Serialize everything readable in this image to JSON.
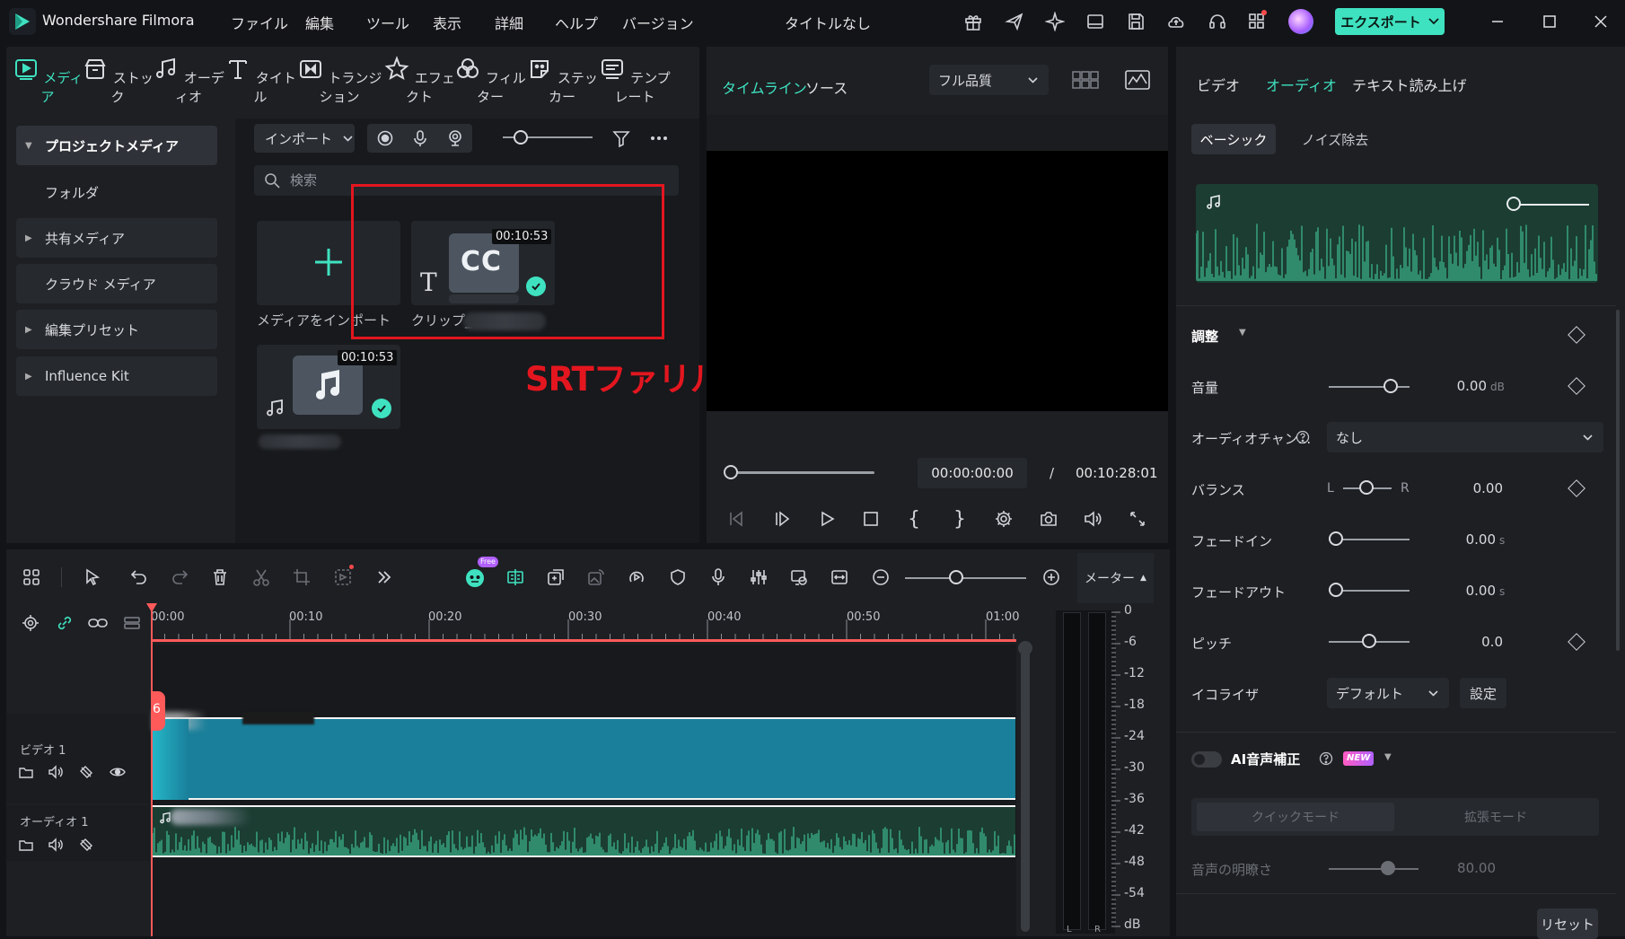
{
  "titlebar": {
    "app_name": "Wondershare Filmora",
    "menu": [
      "ファイル",
      "編集",
      "ツール",
      "表示",
      "詳細",
      "ヘルプ",
      "バージョン"
    ],
    "document_title": "タイトルなし",
    "export_label": "エクスポート"
  },
  "media_tabs": [
    {
      "label": "メディア",
      "icon": "media-icon"
    },
    {
      "label": "ストック",
      "icon": "stock-icon"
    },
    {
      "label": "オーディオ",
      "icon": "music-note-icon"
    },
    {
      "label": "タイトル",
      "icon": "title-t-icon"
    },
    {
      "label": "トランジション",
      "icon": "transition-icon"
    },
    {
      "label": "エフェクト",
      "icon": "effect-star-icon"
    },
    {
      "label": "フィルター",
      "icon": "filter-icon"
    },
    {
      "label": "ステッカー",
      "icon": "sticker-icon"
    },
    {
      "label": "テンプレート",
      "icon": "template-icon"
    }
  ],
  "media_sidebar": [
    {
      "label": "プロジェクトメディア",
      "expandable": true,
      "active": true
    },
    {
      "label": "フォルダ",
      "expandable": false
    },
    {
      "label": "共有メディア",
      "expandable": true
    },
    {
      "label": "クラウド メディア",
      "expandable": false
    },
    {
      "label": "編集プリセット",
      "expandable": true
    },
    {
      "label": "Influence Kit",
      "expandable": true
    }
  ],
  "media_toolbar": {
    "import_label": "インポート",
    "search_placeholder": "検索"
  },
  "media_items": {
    "import_label": "メディアをインポート",
    "clip_label": "クリップ_",
    "clip_duration": "00:10:53",
    "clip_icon_text": "CC",
    "audio_duration": "00:10:53"
  },
  "annotation": "SRTファリルができました",
  "preview": {
    "tab_timeline": "タイムライン",
    "tab_source": "ソース",
    "quality": "フル品質",
    "current_time": "00:00:00:00",
    "separator": "/",
    "total_time": "00:10:28:01"
  },
  "properties": {
    "tabs": [
      "ビデオ",
      "オーディオ",
      "テキスト読み上げ"
    ],
    "subtabs": [
      "ベーシック",
      "ノイズ除去"
    ],
    "section_adjust": "調整",
    "volume_label": "音量",
    "volume_value": "0.00",
    "volume_unit": "dB",
    "channel_label": "オーディオチャン...",
    "channel_value": "なし",
    "balance_label": "バランス",
    "balance_left": "L",
    "balance_right": "R",
    "balance_value": "0.00",
    "fadein_label": "フェードイン",
    "fadein_value": "0.00",
    "fadein_unit": "s",
    "fadeout_label": "フェードアウト",
    "fadeout_value": "0.00",
    "fadeout_unit": "s",
    "pitch_label": "ピッチ",
    "pitch_value": "0.0",
    "eq_label": "イコライザ",
    "eq_value": "デフォルト",
    "eq_settings": "設定",
    "ai_label": "AI音声補正",
    "ai_badge": "NEW",
    "mode_quick": "クイックモード",
    "mode_extended": "拡張モード",
    "clarity_label": "音声の明瞭さ",
    "clarity_value": "80.00",
    "reset_label": "リセット"
  },
  "timeline": {
    "free_badge": "Free",
    "meter_label": "メーター",
    "ruler": [
      "00:00",
      "00:10",
      "00:20",
      "00:30",
      "00:40",
      "00:50",
      "01:00"
    ],
    "video_track": "ビデオ 1",
    "audio_track": "オーディオ 1",
    "playhead_marker": "6",
    "meter_scale": [
      "0",
      "-6",
      "-12",
      "-18",
      "-24",
      "-30",
      "-36",
      "-42",
      "-48",
      "-54",
      "dB"
    ],
    "meter_channels": [
      "L",
      "R"
    ]
  },
  "colors": {
    "accent": "#3fe2c0",
    "annotation_red": "#e3161f",
    "video_clip": "#1a7f9a",
    "audio_wave": "#3fbf92",
    "playhead": "#ff5a5a"
  }
}
